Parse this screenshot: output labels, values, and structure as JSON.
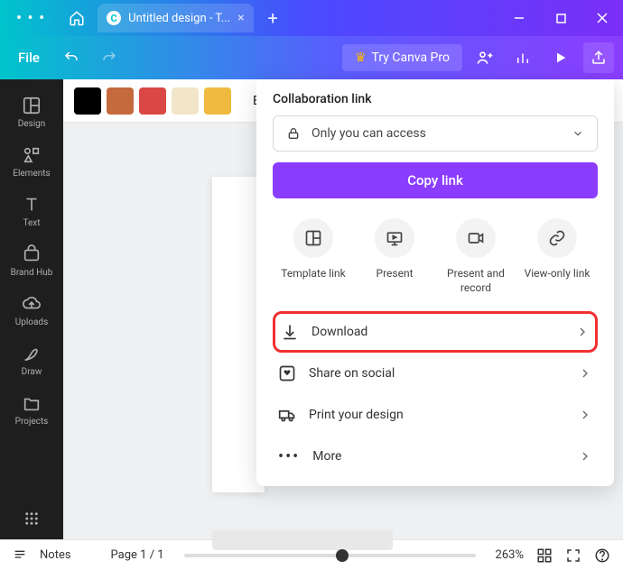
{
  "titlebar": {
    "dots": "• • •",
    "tab_title": "Untitled design - T...",
    "add": "+"
  },
  "toolbar": {
    "file": "File",
    "try_pro": "Try Canva Pro"
  },
  "sidebar": {
    "items": [
      {
        "label": "Design"
      },
      {
        "label": "Elements"
      },
      {
        "label": "Text"
      },
      {
        "label": "Brand Hub"
      },
      {
        "label": "Uploads"
      },
      {
        "label": "Draw"
      },
      {
        "label": "Projects"
      }
    ]
  },
  "colorbar": {
    "swatches": [
      "#000000",
      "#c46a3d",
      "#d94844",
      "#f2e6c9",
      "#f0b940"
    ],
    "edit": "Edit"
  },
  "panel": {
    "collab_title": "Collaboration link",
    "access": "Only you can access",
    "copy": "Copy link",
    "quick": [
      {
        "label": "Template link"
      },
      {
        "label": "Present"
      },
      {
        "label": "Present and record"
      },
      {
        "label": "View-only link"
      }
    ],
    "actions": [
      {
        "label": "Download"
      },
      {
        "label": "Share on social"
      },
      {
        "label": "Print your design"
      },
      {
        "label": "More"
      }
    ]
  },
  "bottom": {
    "notes": "Notes",
    "page": "Page 1 / 1",
    "zoom": "263%"
  }
}
